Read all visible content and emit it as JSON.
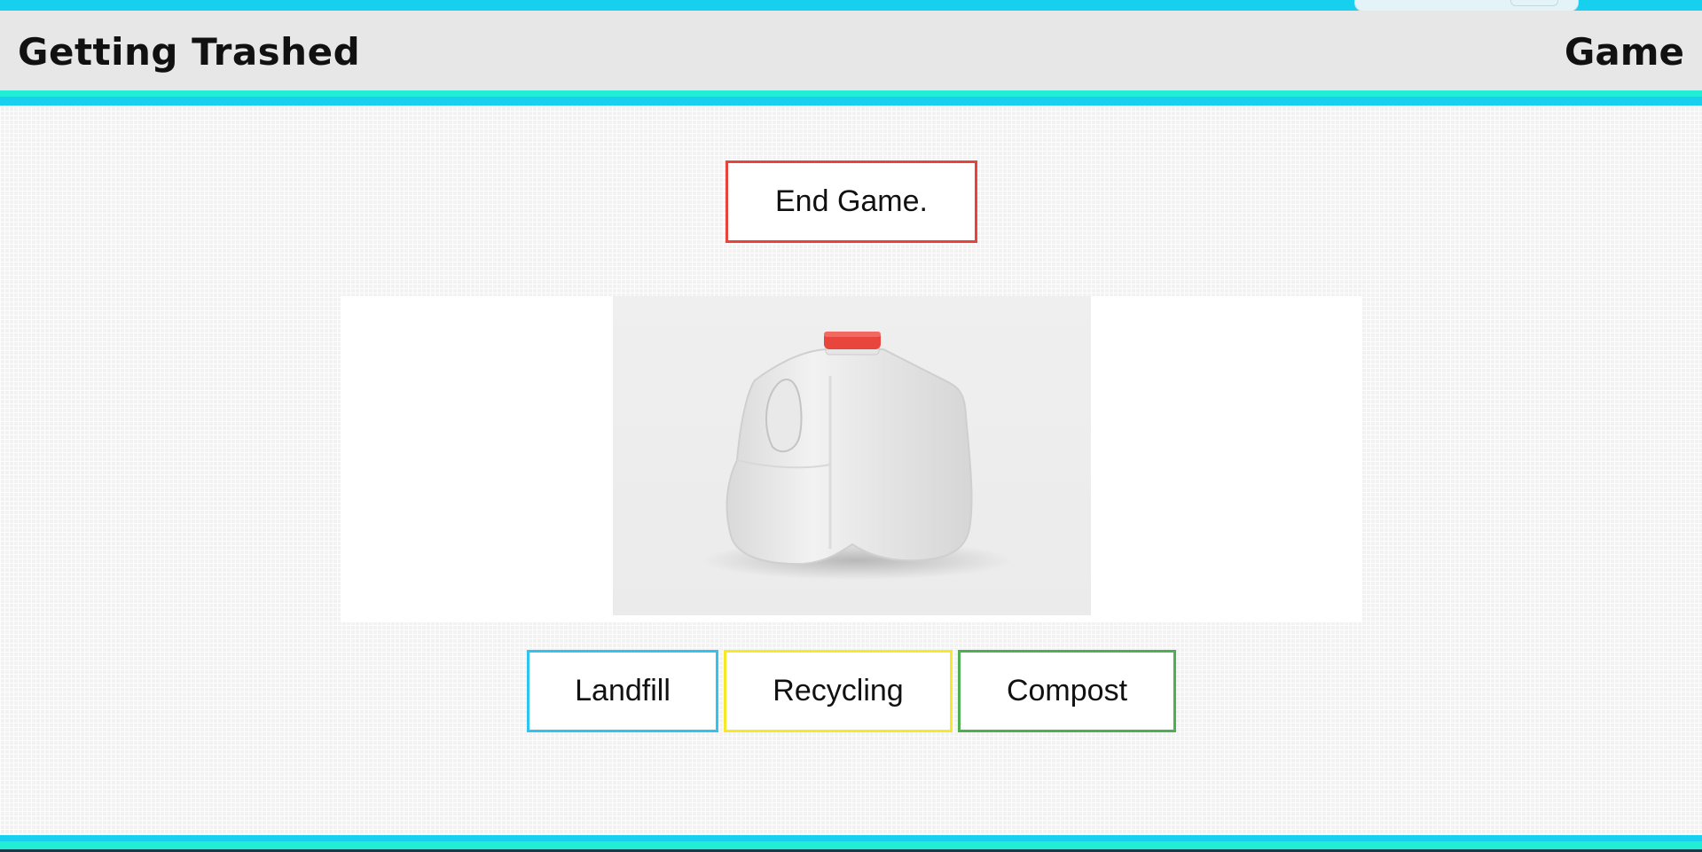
{
  "header": {
    "title": "Getting Trashed",
    "section": "Game"
  },
  "controls": {
    "end_game_label": "End Game."
  },
  "item": {
    "icon": "milk-jug-photo"
  },
  "bins": [
    {
      "label": "Landfill",
      "color": "#2ec4ef"
    },
    {
      "label": "Recycling",
      "color": "#f5e92a"
    },
    {
      "label": "Compost",
      "color": "#4caf50"
    }
  ],
  "theme": {
    "accent_cyan": "#17d0f0",
    "accent_teal": "#22eed6",
    "end_game_border": "#e8433a"
  }
}
